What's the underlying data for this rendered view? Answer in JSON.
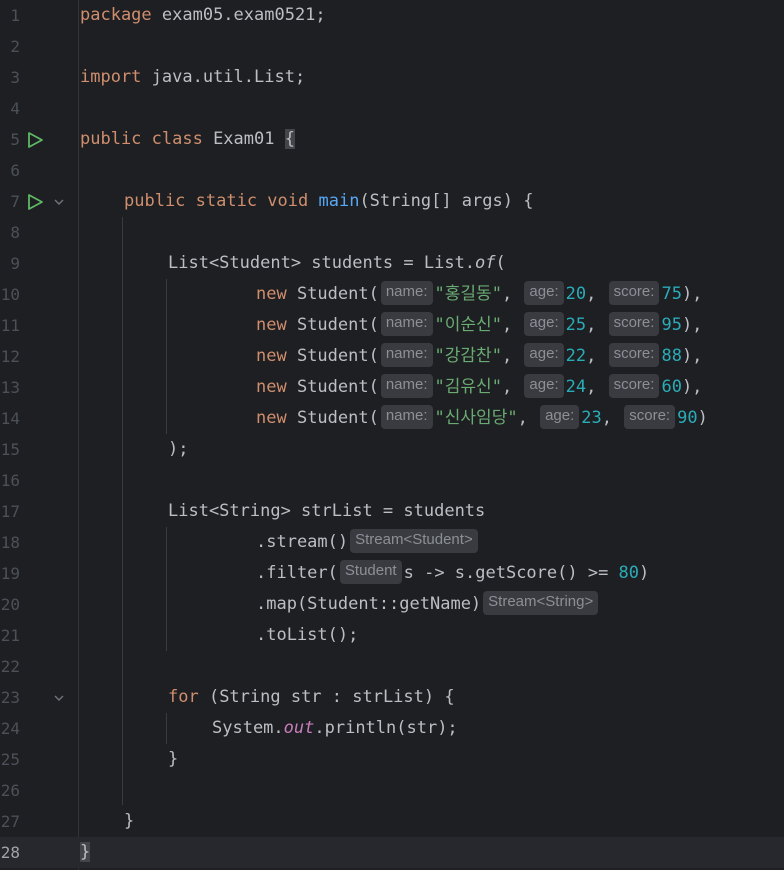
{
  "lines": [
    {
      "n": "1"
    },
    {
      "n": "2"
    },
    {
      "n": "3"
    },
    {
      "n": "4"
    },
    {
      "n": "5"
    },
    {
      "n": "6"
    },
    {
      "n": "7"
    },
    {
      "n": "8"
    },
    {
      "n": "9"
    },
    {
      "n": "10"
    },
    {
      "n": "11"
    },
    {
      "n": "12"
    },
    {
      "n": "13"
    },
    {
      "n": "14"
    },
    {
      "n": "15"
    },
    {
      "n": "16"
    },
    {
      "n": "17"
    },
    {
      "n": "18"
    },
    {
      "n": "19"
    },
    {
      "n": "20"
    },
    {
      "n": "21"
    },
    {
      "n": "22"
    },
    {
      "n": "23"
    },
    {
      "n": "24"
    },
    {
      "n": "25"
    },
    {
      "n": "26"
    },
    {
      "n": "27"
    },
    {
      "n": "28"
    }
  ],
  "code": {
    "l1": {
      "kw": "package",
      "rest": " exam05.exam0521;"
    },
    "l3": {
      "kw": "import",
      "rest": " java.util.List;"
    },
    "l5": {
      "kw": "public class",
      "name": " Exam01 ",
      "brace": "{"
    },
    "l7": {
      "kw": "public static void",
      "fn": "main",
      "rest": "(String[] args) {"
    },
    "l9": {
      "pre": "List<Student> students = List.",
      "of": "of",
      "post": "("
    },
    "students": [
      {
        "new": "new",
        "cls": " Student(",
        "h_name": "name:",
        "name": "\"홍길동\"",
        "sep1": ", ",
        "h_age": "age:",
        "age": "20",
        "sep2": ", ",
        "h_score": "score:",
        "score": "75",
        "end": "),"
      },
      {
        "new": "new",
        "cls": " Student(",
        "h_name": "name:",
        "name": "\"이순신\"",
        "sep1": ", ",
        "h_age": "age:",
        "age": "25",
        "sep2": ", ",
        "h_score": "score:",
        "score": "95",
        "end": "),"
      },
      {
        "new": "new",
        "cls": " Student(",
        "h_name": "name:",
        "name": "\"강감찬\"",
        "sep1": ", ",
        "h_age": "age:",
        "age": "22",
        "sep2": ", ",
        "h_score": "score:",
        "score": "88",
        "end": "),"
      },
      {
        "new": "new",
        "cls": " Student(",
        "h_name": "name:",
        "name": "\"김유신\"",
        "sep1": ", ",
        "h_age": "age:",
        "age": "24",
        "sep2": ", ",
        "h_score": "score:",
        "score": "60",
        "end": "),"
      },
      {
        "new": "new",
        "cls": " Student(",
        "h_name": "name:",
        "name": "\"신사임당\"",
        "sep1": ", ",
        "h_age": "age:",
        "age": "23",
        "sep2": ", ",
        "h_score": "score:",
        "score": "90",
        "end": ")"
      }
    ],
    "l15": {
      "text": ");"
    },
    "l17": {
      "text": "List<String> strList = students"
    },
    "l18": {
      "text": ".stream()",
      "hint": "Stream<Student>"
    },
    "l19": {
      "pre": ".filter(",
      "hint": "Student",
      "mid": "s -> s.getScore() >= ",
      "num": "80",
      "post": ")"
    },
    "l20": {
      "text": ".map(Student::getName)",
      "hint": "Stream<String>"
    },
    "l21": {
      "text": ".toList();"
    },
    "l23": {
      "kw": "for",
      "rest": " (String str : strList) {"
    },
    "l24": {
      "pre": "System.",
      "out": "out",
      "post": ".println(str);"
    },
    "l25": {
      "text": "}"
    },
    "l27": {
      "text": "}"
    },
    "l28": {
      "text": "}"
    }
  },
  "colors": {
    "background": "#1e1f22",
    "keyword": "#cf8e6d",
    "function": "#56a8f5",
    "string": "#6aab73",
    "number": "#2aacb8",
    "static_field": "#c77dbb",
    "hint_bg": "#393b40",
    "run_icon": "#5fb865"
  },
  "icons": {
    "run": "run-triangle-icon",
    "fold": "fold-chevron-icon"
  }
}
